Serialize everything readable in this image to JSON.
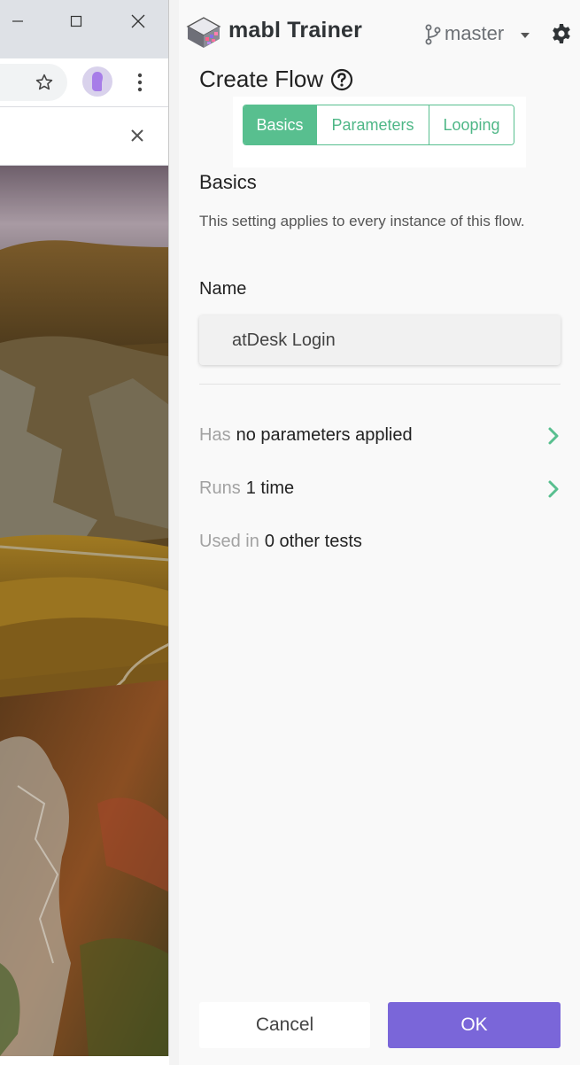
{
  "browser": {
    "window_controls": {
      "minimize_icon": "minimize-icon",
      "maximize_icon": "maximize-icon",
      "close_icon": "close-icon"
    },
    "toolbar": {
      "bookmark_icon": "star-icon",
      "profile_icon": "profile-icon",
      "menu_icon": "more-vert-icon"
    },
    "infobar": {
      "close_icon": "close-icon"
    },
    "page_image": "mountain landscape"
  },
  "header": {
    "app_title": "mabl Trainer",
    "branch": "master",
    "branch_icon": "git-branch-icon",
    "settings_icon": "gear-icon"
  },
  "create_flow": {
    "title": "Create Flow",
    "help_icon": "question-circle-icon"
  },
  "tabs": [
    {
      "label": "Basics",
      "active": true
    },
    {
      "label": "Parameters",
      "active": false
    },
    {
      "label": "Looping",
      "active": false
    }
  ],
  "basics": {
    "title": "Basics",
    "description": "This setting applies to every instance of this flow.",
    "name_label": "Name",
    "name_value": "atDesk Login"
  },
  "summary": {
    "parameters": {
      "muted": "Has",
      "strong": "no parameters applied"
    },
    "runs": {
      "muted": "Runs",
      "strong": "1 time"
    },
    "used": {
      "muted": "Used in",
      "strong": "0 other tests"
    }
  },
  "footer": {
    "cancel_label": "Cancel",
    "ok_label": "OK"
  },
  "colors": {
    "accent_green": "#58bf8f",
    "primary_purple": "#7a66d9",
    "panel_bg": "#f9f9f9"
  }
}
